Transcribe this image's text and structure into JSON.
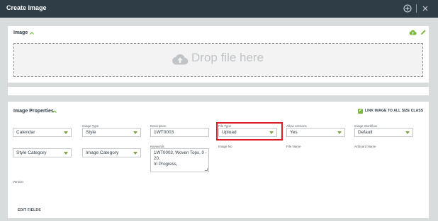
{
  "header": {
    "title": "Create Image"
  },
  "image_section": {
    "title": "Image",
    "dropzone_text": "Drop file here"
  },
  "properties": {
    "title": "Image Properties",
    "link_all_label": "LINK IMAGE TO ALL SIZE CLASS",
    "fields": {
      "row1": {
        "calendar": {
          "label": "",
          "value": "Calendar"
        },
        "image_type": {
          "label": "Image Type",
          "value": "Style"
        },
        "description": {
          "label": "Description",
          "value": "1WT0003"
        },
        "file_type": {
          "label": "File Type",
          "value": "Upload"
        },
        "allow_versions": {
          "label": "Allow versions",
          "value": "Yes"
        },
        "image_workflow": {
          "label": "Image Workflow",
          "value": "Default"
        }
      },
      "row2": {
        "style_category": {
          "value": "Style Category"
        },
        "image_category": {
          "value": "Image Category"
        },
        "keywords": {
          "label": "Keywords",
          "value": "1WT0003, Woven Tops, 0 - 20,\nIn Progress,"
        },
        "image_no": {
          "label": "Image No"
        },
        "file_name": {
          "label": "File Name"
        },
        "artboard_name": {
          "label": "Artboard Name"
        }
      },
      "version": {
        "label": "Version"
      }
    },
    "edit_fields_label": "EDIT FIELDS"
  },
  "colors": {
    "topbar": "#2f3d47",
    "accent": "#78b83a",
    "highlight": "#e01a22"
  }
}
